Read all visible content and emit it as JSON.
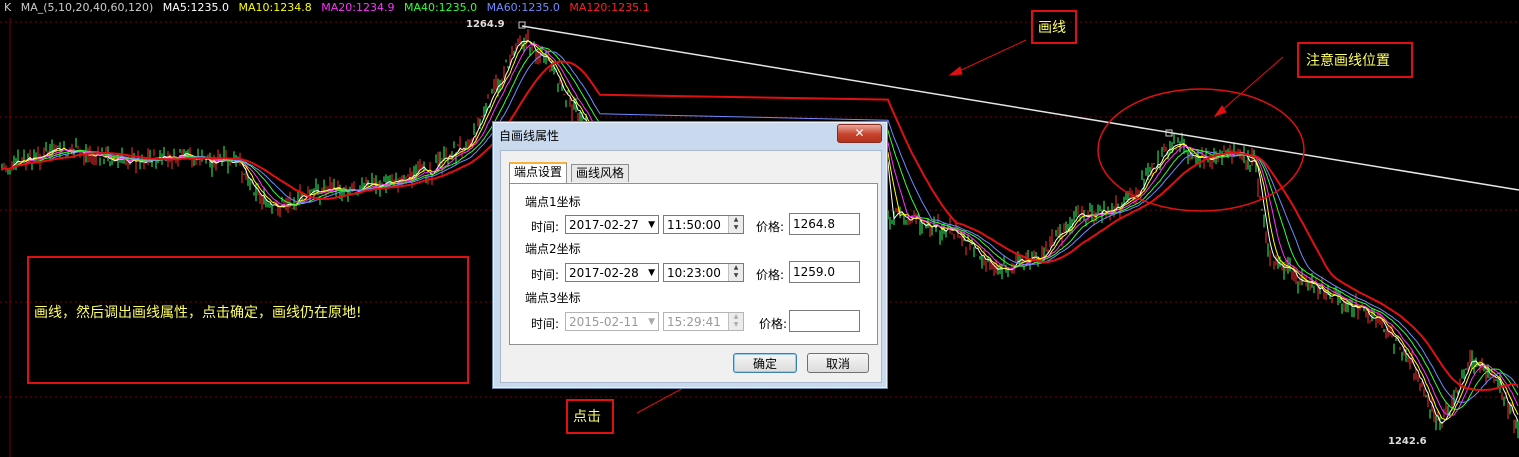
{
  "legend": {
    "prefix": "K",
    "ma_spec": "MA_(5,10,20,40,60,120)",
    "items": [
      {
        "text": "MA5:1235.0",
        "color": "#ffffff"
      },
      {
        "text": "MA10:1234.8",
        "color": "#ffff00"
      },
      {
        "text": "MA20:1234.9",
        "color": "#ff33ff"
      },
      {
        "text": "MA40:1235.0",
        "color": "#33ff33"
      },
      {
        "text": "MA60:1235.0",
        "color": "#6f8cff"
      },
      {
        "text": "MA120:1235.1",
        "color": "#ff2020"
      }
    ]
  },
  "chart": {
    "high_label": "1264.9",
    "low_label": "1242.6"
  },
  "annotations": {
    "draw_line": "画线",
    "note_position": "注意画线位置",
    "click": "点击",
    "description": "画线，然后调出画线属性，点击确定，画线仍在原地!"
  },
  "dialog": {
    "title": "自画线属性",
    "close": "✕",
    "tabs": [
      "端点设置",
      "画线风格"
    ],
    "time_label": "时间:",
    "price_label": "价格:",
    "points": [
      {
        "header": "端点1坐标",
        "date": "2017-02-27",
        "time": "11:50:00",
        "price": "1264.8"
      },
      {
        "header": "端点2坐标",
        "date": "2017-02-28",
        "time": "10:23:00",
        "price": "1259.0"
      },
      {
        "header": "端点3坐标",
        "date": "2015-02-11",
        "time": "15:29:41",
        "price": ""
      }
    ],
    "ok": "确定",
    "cancel": "取消"
  }
}
